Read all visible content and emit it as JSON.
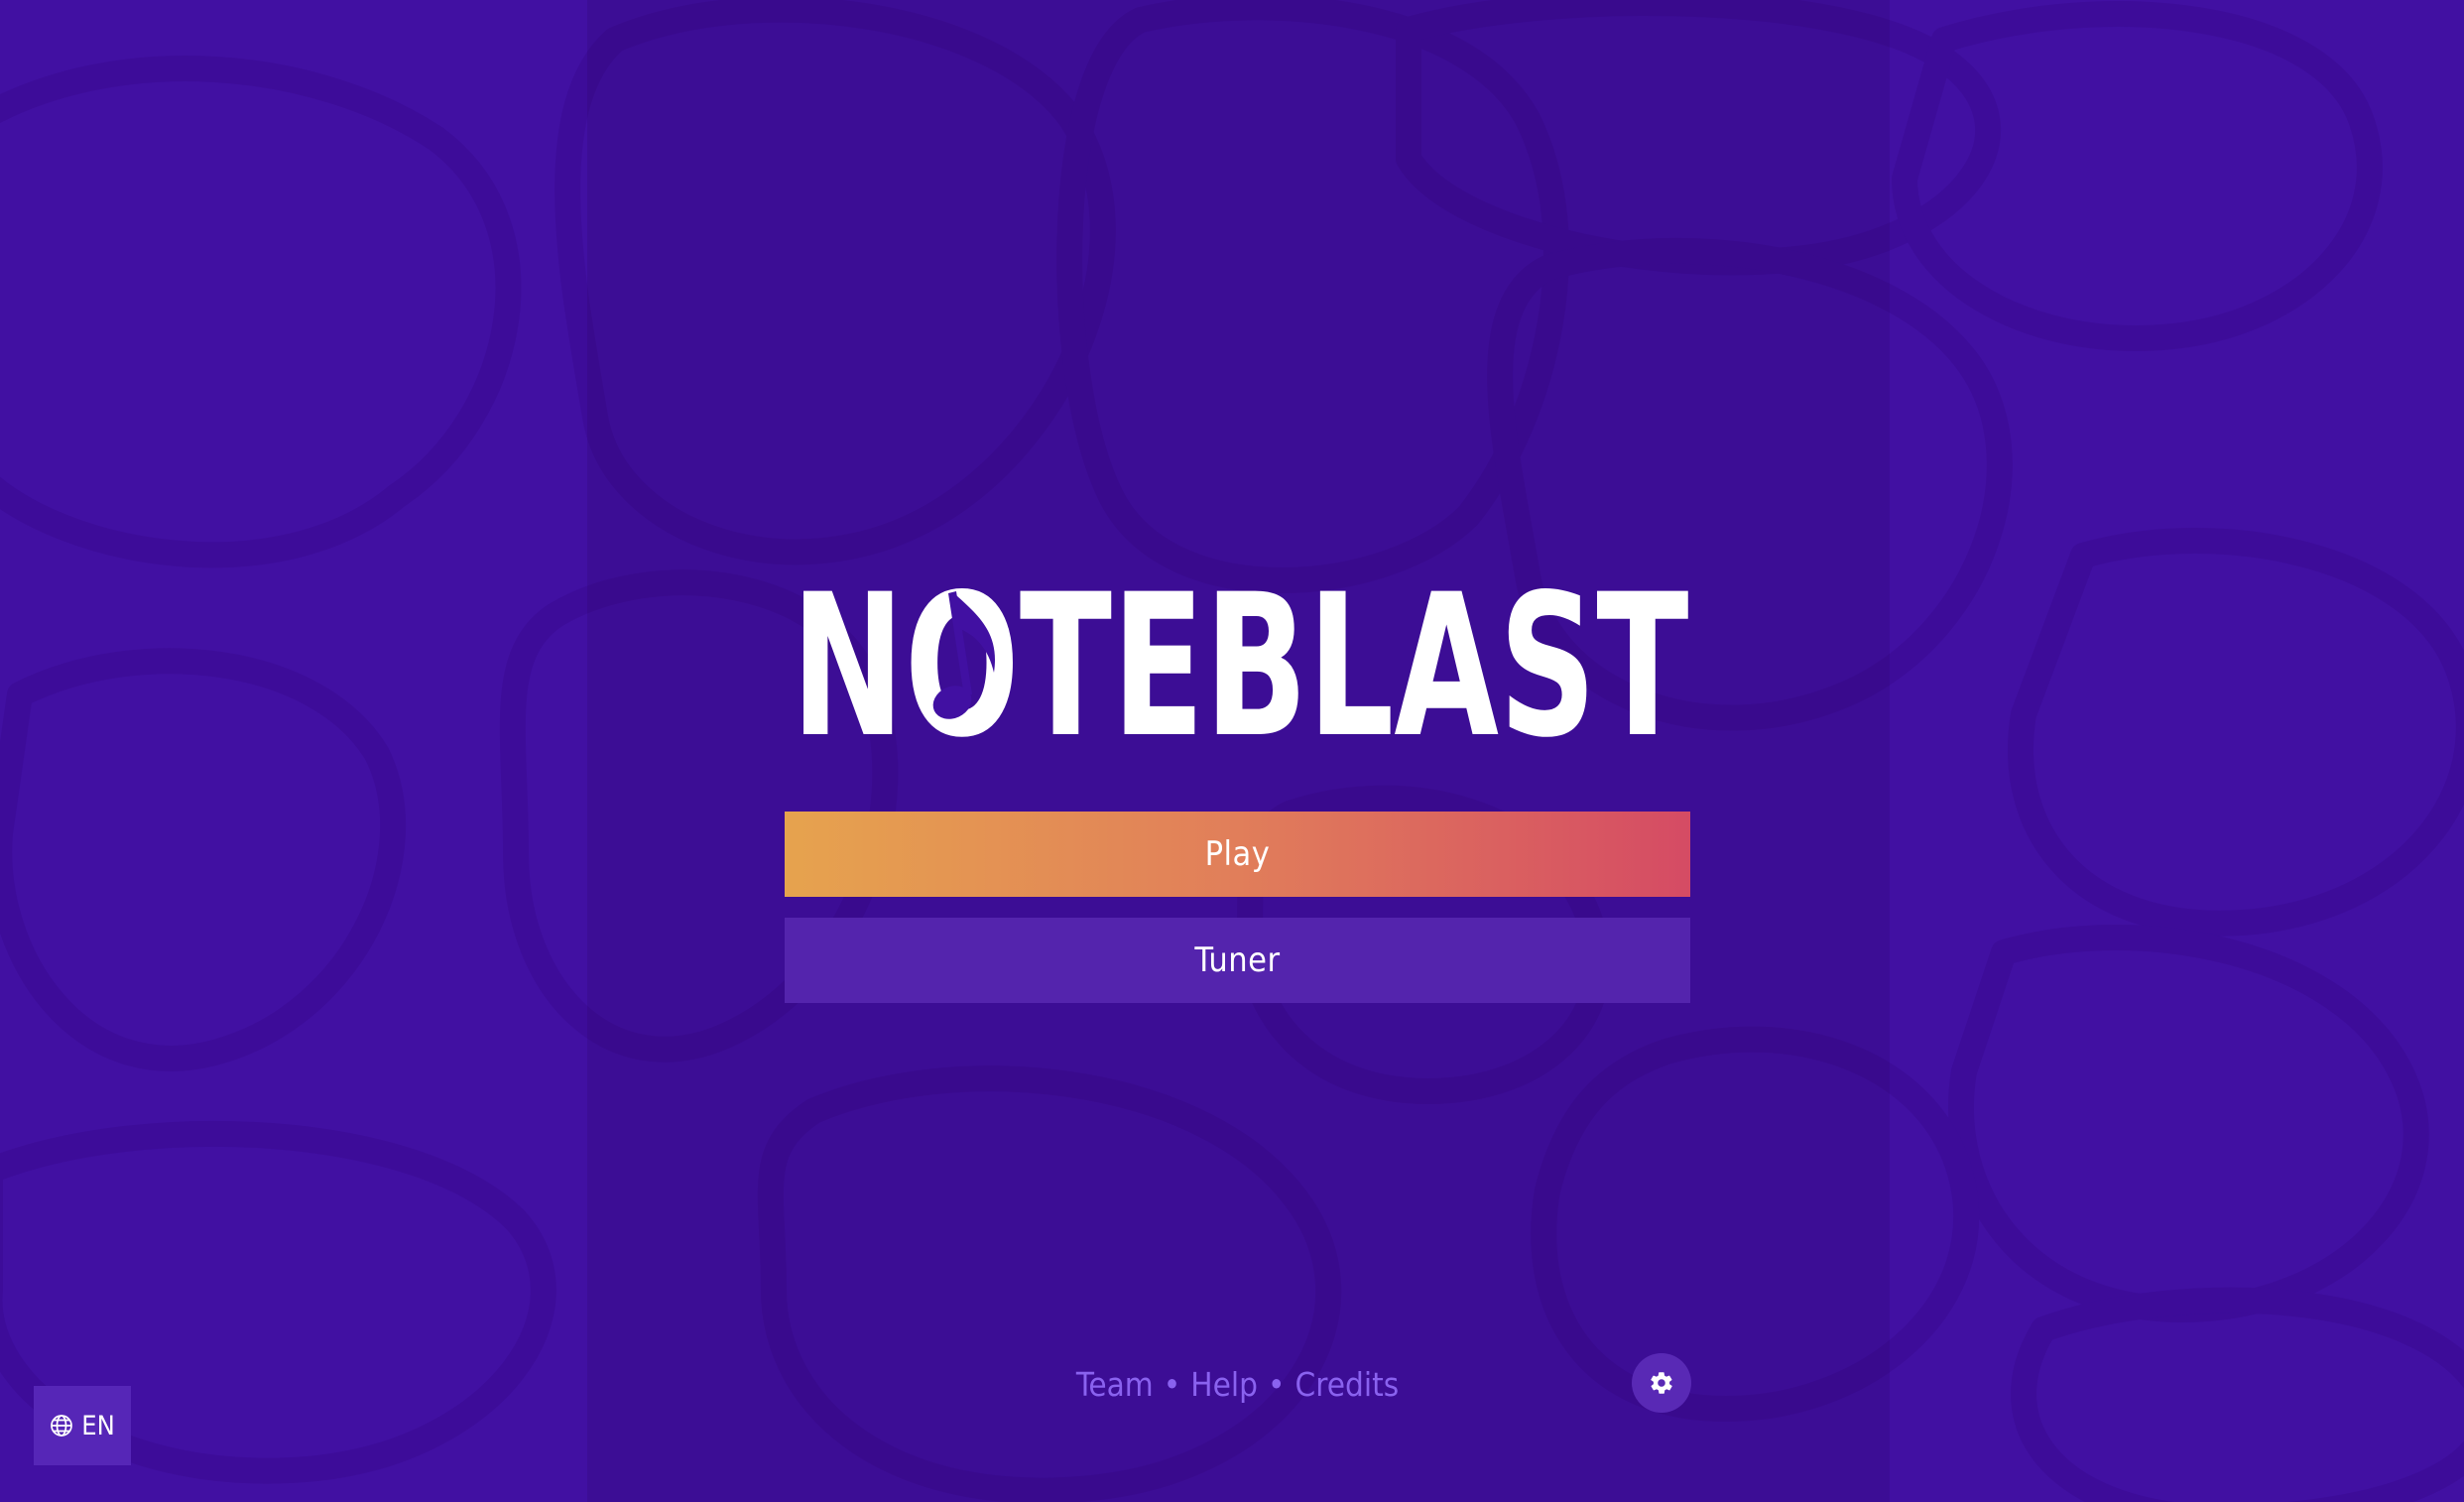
{
  "app": {
    "logo_text": "NOTEBLAST"
  },
  "menu": {
    "play_label": "Play",
    "tuner_label": "Tuner"
  },
  "footer": {
    "team_label": "Team",
    "help_label": "Help",
    "credits_label": "Credits",
    "separator": "•"
  },
  "language": {
    "current": "EN"
  },
  "icons": {
    "settings": "gear-icon",
    "language": "globe-icon",
    "logo_note": "music-note-icon"
  },
  "colors": {
    "background": "#4110a2",
    "play_gradient_start": "#e6a34e",
    "play_gradient_end": "#d54b64",
    "tuner_button": "#5424ad",
    "footer_link": "#8a62ef",
    "text": "#ffffff"
  }
}
